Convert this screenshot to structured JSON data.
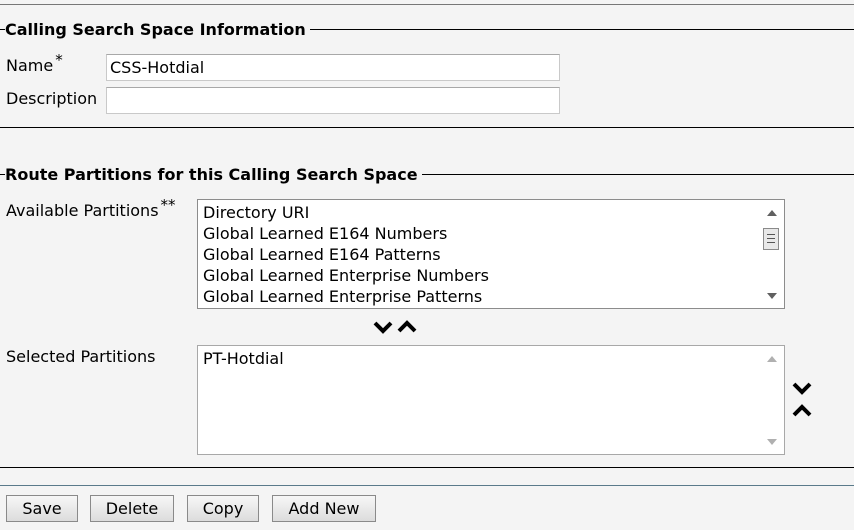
{
  "css_info": {
    "title": "Calling Search Space Information",
    "name_label": "Name",
    "name_required": "*",
    "name_value": "CSS-Hotdial",
    "description_label": "Description",
    "description_value": ""
  },
  "route_partitions": {
    "title": "Route Partitions for this Calling Search Space",
    "available_label": "Available Partitions",
    "available_required": "**",
    "available_items": [
      "Directory URI",
      "Global Learned E164 Numbers",
      "Global Learned E164 Patterns",
      "Global Learned Enterprise Numbers",
      "Global Learned Enterprise Patterns"
    ],
    "selected_label": "Selected Partitions",
    "selected_items": [
      "PT-Hotdial"
    ]
  },
  "buttons": {
    "save": "Save",
    "delete": "Delete",
    "copy": "Copy",
    "add_new": "Add New"
  },
  "icons": {
    "move_down": "chevron-down-icon",
    "move_up": "chevron-up-icon",
    "scroll_up": "scroll-up-arrow-icon",
    "scroll_down": "scroll-down-arrow-icon"
  }
}
